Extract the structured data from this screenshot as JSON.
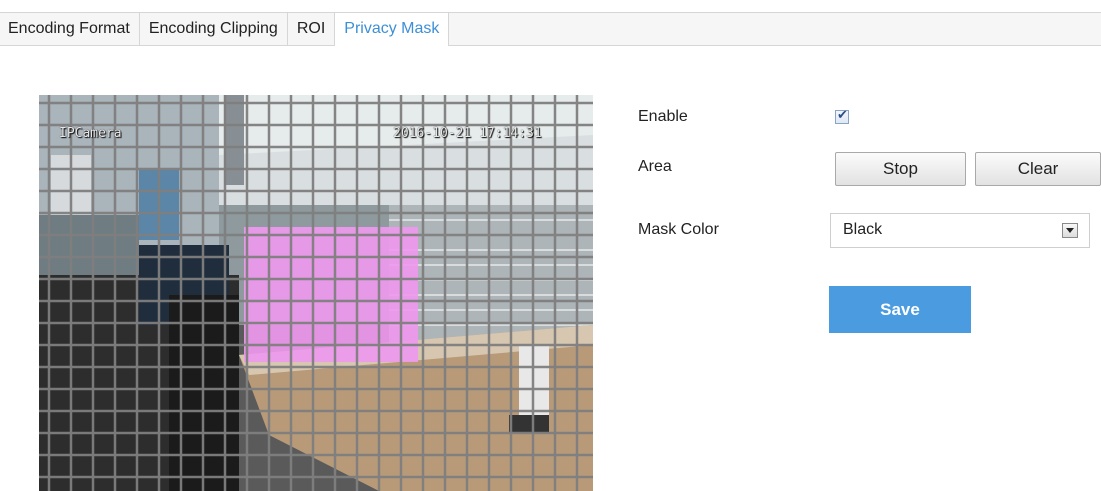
{
  "tabs": [
    {
      "label": "Encoding Format",
      "active": false
    },
    {
      "label": "Encoding Clipping",
      "active": false
    },
    {
      "label": "ROI",
      "active": false
    },
    {
      "label": "Privacy Mask",
      "active": true
    }
  ],
  "video": {
    "osd_name": "IPCamera",
    "osd_time": "2016-10-21 17:14:31",
    "mask_color_fill": "#ee99ee"
  },
  "settings": {
    "enable_label": "Enable",
    "enable_checked": true,
    "area_label": "Area",
    "stop_label": "Stop",
    "clear_label": "Clear",
    "mask_color_label": "Mask Color",
    "mask_color_value": "Black",
    "save_label": "Save"
  },
  "colors": {
    "accent": "#4a9be0",
    "active_tab_text": "#3d8fd6"
  }
}
